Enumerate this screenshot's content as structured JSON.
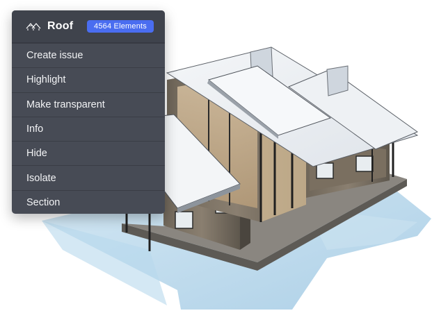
{
  "context_menu": {
    "title": "Roof",
    "icon": "roof-icon",
    "badge": "4564 Elements",
    "items": [
      {
        "label": "Create issue"
      },
      {
        "label": "Highlight"
      },
      {
        "label": "Make transparent"
      },
      {
        "label": "Info"
      },
      {
        "label": "Hide"
      },
      {
        "label": "Isolate"
      },
      {
        "label": "Section"
      }
    ]
  },
  "colors": {
    "menu_bg": "#474b55",
    "header_bg": "#3f434c",
    "badge_bg": "#4a6df0",
    "ground_shadow": "#a9cfe6"
  }
}
